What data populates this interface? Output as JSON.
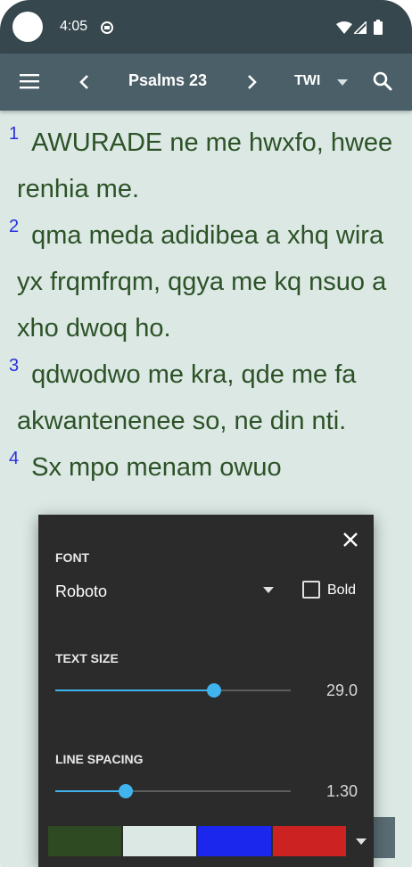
{
  "status_bar": {
    "time": "4:05"
  },
  "toolbar": {
    "title": "Psalms 23",
    "version": "TWI"
  },
  "verses": [
    {
      "num": "1",
      "text": "AWURADE ne me hwxfo, hwee renhia me."
    },
    {
      "num": "2",
      "text": "qma meda adidibea a xhq wira yx frqmfrqm, qgya me kq nsuo a xho dwoq ho."
    },
    {
      "num": "3",
      "text": "qdwodwo me kra, qde me fa akwantenenee so, ne din nti."
    },
    {
      "num": "4",
      "text": "Sx mpo menam owuo"
    }
  ],
  "dialog": {
    "font_label": "FONT",
    "font_value": "Roboto",
    "bold_label": "Bold",
    "text_size_label": "TEXT SIZE",
    "text_size_value": "29.0",
    "text_size_fraction": 0.675,
    "line_spacing_label": "LINE SPACING",
    "line_spacing_value": "1.30",
    "line_spacing_fraction": 0.3,
    "colors": [
      "#2e4a22",
      "#dbe8e4",
      "#1c27ee",
      "#cc2222"
    ]
  },
  "theme": {
    "status_bar": "#36474d",
    "toolbar": "#4a5f68",
    "background": "#dbe8e4",
    "verse_text": "#2d5227",
    "verse_number": "#2a2fe0",
    "slider_accent": "#40b4ec"
  },
  "icons": [
    "camera-icon",
    "android-notification-icon",
    "wifi-icon",
    "signal-icon",
    "battery-icon",
    "menu-icon",
    "chevron-left-icon",
    "chevron-right-icon",
    "dropdown-arrow-icon",
    "search-icon",
    "close-icon"
  ]
}
